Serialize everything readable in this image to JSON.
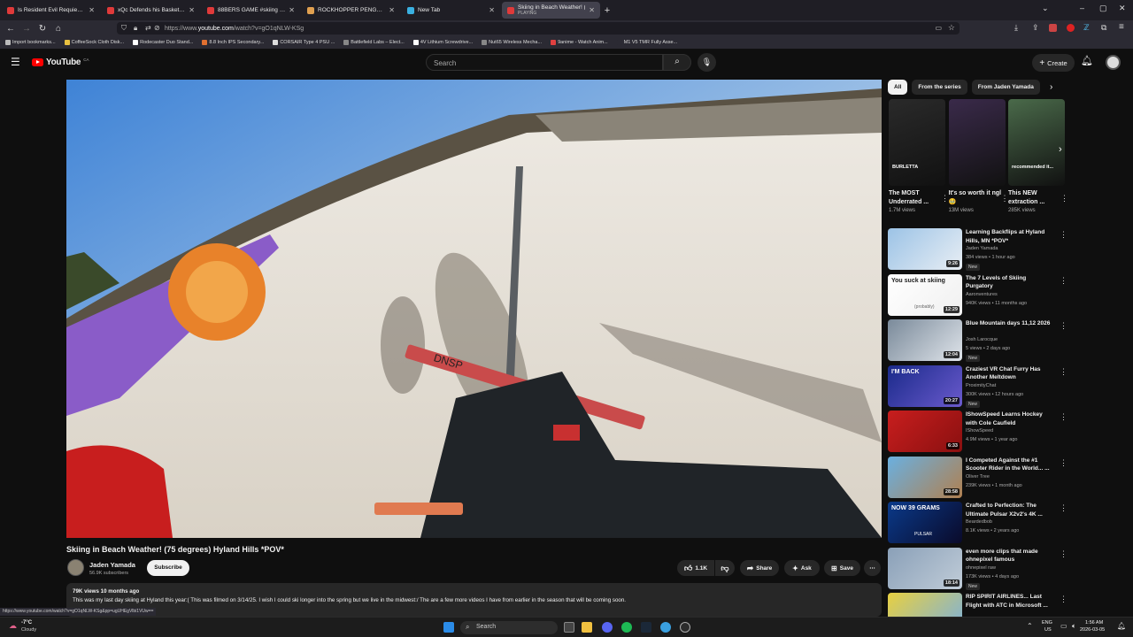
{
  "browser": {
    "tabs": [
      {
        "title": "Is Resident Evil Requiem Good",
        "color": "#e03a3a"
      },
      {
        "title": "xQc Defends his Basketball Ski",
        "color": "#e03a3a"
      },
      {
        "title": "88BERS GAME #skiing #bigair",
        "color": "#e03a3a"
      },
      {
        "title": "ROCKHOPPER PENGUIN at Du",
        "color": "#e0a050"
      },
      {
        "title": "New Tab",
        "color": "#3ab0e0"
      },
      {
        "title": "Skiing in Beach Weather! (75 d",
        "subtitle": "PLAYING",
        "color": "#e03a3a",
        "active": true
      }
    ],
    "new_tab_label": "+",
    "url_prefix": "https://www.",
    "url_domain": "youtube.com",
    "url_rest": "/watch?v=gO1qNLW-KSg",
    "bookmarks": [
      {
        "label": "Import bookmarks...",
        "color": "#bbbbbb"
      },
      {
        "label": "CoffeeSock Cloth Disk...",
        "color": "#e8c040"
      },
      {
        "label": "Rodecaster Duo Stand...",
        "color": "#ffffff"
      },
      {
        "label": "8.8 Inch IPS Secondary...",
        "color": "#e07030"
      },
      {
        "label": "CORSAIR Type 4 PSU ...",
        "color": "#dddddd"
      },
      {
        "label": "Battlefield Labs – Elect...",
        "color": "#888888"
      },
      {
        "label": "4V Lithium Screwdrive...",
        "color": "#ffffff"
      },
      {
        "label": "Nut65 Wireless Mecha...",
        "color": "#888888"
      },
      {
        "label": "9anime - Watch Anim...",
        "color": "#e04040"
      },
      {
        "label": "M1 V5 TMR Fully Asse...",
        "color": "#2b2a33"
      }
    ]
  },
  "youtube": {
    "logo_text": "YouTube",
    "country": "CA",
    "search_placeholder": "Search",
    "create_label": "Create",
    "accent": "#ff0000"
  },
  "video": {
    "title": "Skiing in Beach Weather! (75 degrees) Hyland Hills *POV*",
    "channel": "Jaden Yamada",
    "subscribers": "56.9K subscribers",
    "subscribe_label": "Subscribe",
    "likes": "1.1K",
    "share_label": "Share",
    "ask_label": "Ask",
    "save_label": "Save",
    "views_age": "79K views  10 months ago",
    "description": "This was my last day skiing at Hyland this year:( This was filmed on 3/14/25. I wish I could ski longer into the spring but we live in the midwest:/ The are a few more videos I have from earlier in the season that will be coming soon.",
    "ski_text": "DNSP"
  },
  "sidebar": {
    "chips": [
      {
        "label": "All",
        "active": true
      },
      {
        "label": "From the series"
      },
      {
        "label": "From Jaden Yamada"
      }
    ],
    "shelf": [
      {
        "title": "The MOST Underrated ...",
        "views": "1.7M views",
        "overlay": "BURLETTA",
        "bg": "#2a2a2a"
      },
      {
        "title": "It's so worth it ngl 🥹",
        "views": "13M views",
        "overlay": "",
        "bg": "#3a2a4a"
      },
      {
        "title": "This NEW extraction ...",
        "views": "285K views",
        "overlay": "recommended it...",
        "bg": "#4a6a4a"
      }
    ],
    "recommendations": [
      {
        "title": "Learning Backflips at Hyland Hills, MN *POV*",
        "channel": "Jaden Yamada",
        "views": "384 views • 1 hour ago",
        "new": "New",
        "duration": "9:26",
        "thumb": [
          "#9cc3e6",
          "#e8eef4"
        ]
      },
      {
        "title": "The 7 Levels of Skiing Purgatory",
        "channel": "Aaronventures",
        "views": "940K views • 11 months ago",
        "new": "",
        "duration": "12:29",
        "thumb": [
          "#ffffff",
          "#f0f0f0"
        ],
        "thumb_text": "You suck at skiing",
        "thumb_sub": "(probably)"
      },
      {
        "title": "Blue Mountain days 11,12 2026",
        "channel": "Josh Larocque",
        "views": "5 views • 2 days ago",
        "new": "New",
        "duration": "12:04",
        "thumb": [
          "#7a8a9a",
          "#dfe4ea"
        ]
      },
      {
        "title": "Craziest VR Chat Furry Has Another Meltdown",
        "channel": "ProximityChat",
        "views": "300K views • 12 hours ago",
        "new": "New",
        "duration": "20:27",
        "thumb": [
          "#1a2a8a",
          "#6a5acd"
        ],
        "thumb_text": "I'M BACK"
      },
      {
        "title": "IShowSpeed Learns Hockey with Cole Caufield",
        "channel": "IShowSpeed",
        "views": "4.9M views • 1 year ago",
        "new": "",
        "duration": "6:33",
        "thumb": [
          "#c81e1e",
          "#8a1010"
        ]
      },
      {
        "title": "I Competed Against the #1 Scooter Rider in the World... ...",
        "channel": "Oliver Tree",
        "views": "239K views • 1 month ago",
        "new": "",
        "duration": "28:58",
        "thumb": [
          "#6ab0e0",
          "#b08050"
        ]
      },
      {
        "title": "Crafted to Perfection: The Ultimate Pulsar X2v2's 4K ...",
        "channel": "Beardedbob",
        "views": "8.1K views • 2 years ago",
        "new": "",
        "duration": "",
        "thumb": [
          "#0a3a8a",
          "#0a0a2a"
        ],
        "thumb_text": "NOW 39 GRAMS",
        "thumb_sub": "PULSAR"
      },
      {
        "title": "even more clips that made ohnepixel famous",
        "channel": "ohnepixel raw",
        "views": "173K views • 4 days ago",
        "new": "New",
        "duration": "18:14",
        "thumb": [
          "#8aa0b8",
          "#c0ccd8"
        ]
      },
      {
        "title": "RIP SPIRIT AIRLINES... Last Flight with ATC in Microsoft ...",
        "channel": "",
        "views": "",
        "new": "",
        "duration": "",
        "thumb": [
          "#e8d040",
          "#7ab0e0"
        ]
      }
    ]
  },
  "status_link": "https://www.youtube.com/watch?v=gO1qNLW-KSg&pp=ugUHEgVlbi1VUw==",
  "taskbar": {
    "temperature": "-7°C",
    "weather": "Cloudy",
    "search_label": "Search",
    "lang": "ENG",
    "region": "US",
    "time": "1:56 AM",
    "date": "2026-03-05"
  }
}
